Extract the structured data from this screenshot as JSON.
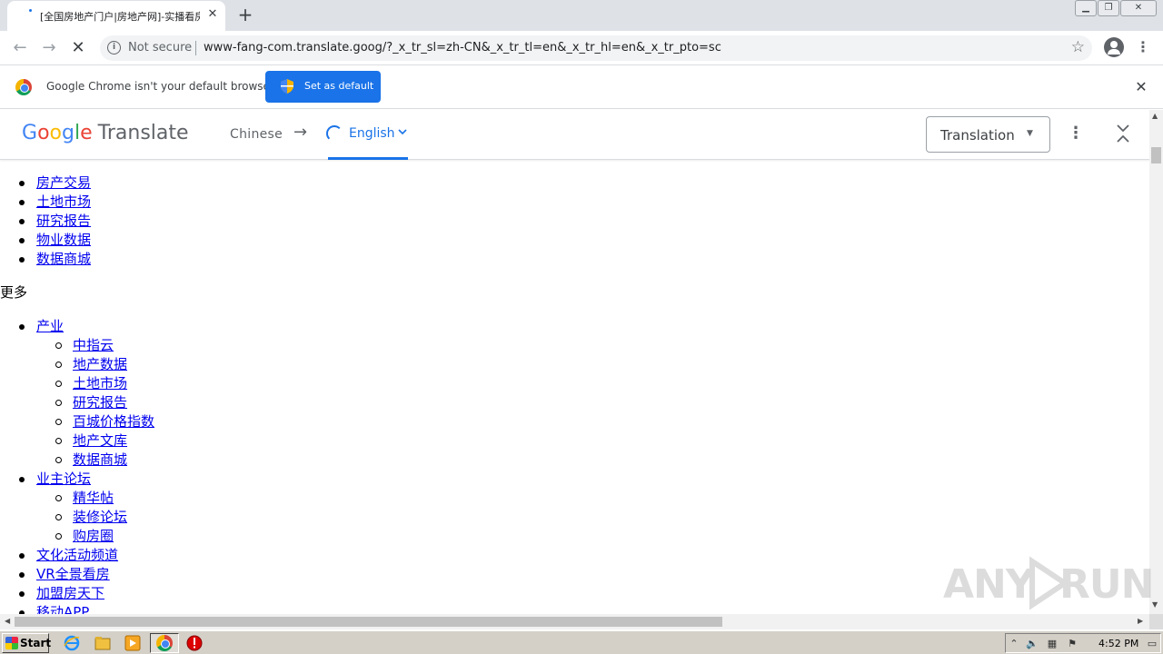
{
  "browser": {
    "tab_title": "[全国房地产门户|房地产网]-实播看房",
    "tab_close": "✕",
    "new_tab": "+",
    "security_label": "Not secure",
    "url": "www-fang-com.translate.goog/?_x_tr_sl=zh-CN&_x_tr_tl=en&_x_tr_hl=en&_x_tr_pto=sc"
  },
  "infobar": {
    "message": "Google Chrome isn't your default browser",
    "button_label": "Set as default"
  },
  "translate_bar": {
    "logo_google": [
      "G",
      "o",
      "o",
      "g",
      "l",
      "e"
    ],
    "logo_translate": "Translate",
    "source_language": "Chinese",
    "arrow": "→",
    "target_language": "English",
    "view_select": "Translation"
  },
  "content": {
    "nav_top": [
      "房产交易",
      "土地市场",
      "研究报告",
      "物业数据",
      "数据商城"
    ],
    "more_label": "更多",
    "sections": [
      {
        "label": "产业",
        "items": [
          "中指云",
          "地产数据",
          "土地市场",
          "研究报告",
          "百城价格指数",
          "地产文库",
          "数据商城"
        ]
      },
      {
        "label": "业主论坛",
        "items": [
          "精华帖",
          "装修论坛",
          "购房圈"
        ]
      }
    ],
    "nav_bottom": [
      "文化活动频道",
      "VR全景看房",
      "加盟房天下",
      "移动APP"
    ]
  },
  "watermark": {
    "text_left": "ANY",
    "text_right": "RUN"
  },
  "taskbar": {
    "start_label": "Start",
    "clock": "4:52 PM"
  },
  "colors": {
    "link": "#0000ee",
    "accent_blue": "#1a73e8",
    "tab_strip": "#dee1e6",
    "taskbar": "#d4d0c8"
  }
}
